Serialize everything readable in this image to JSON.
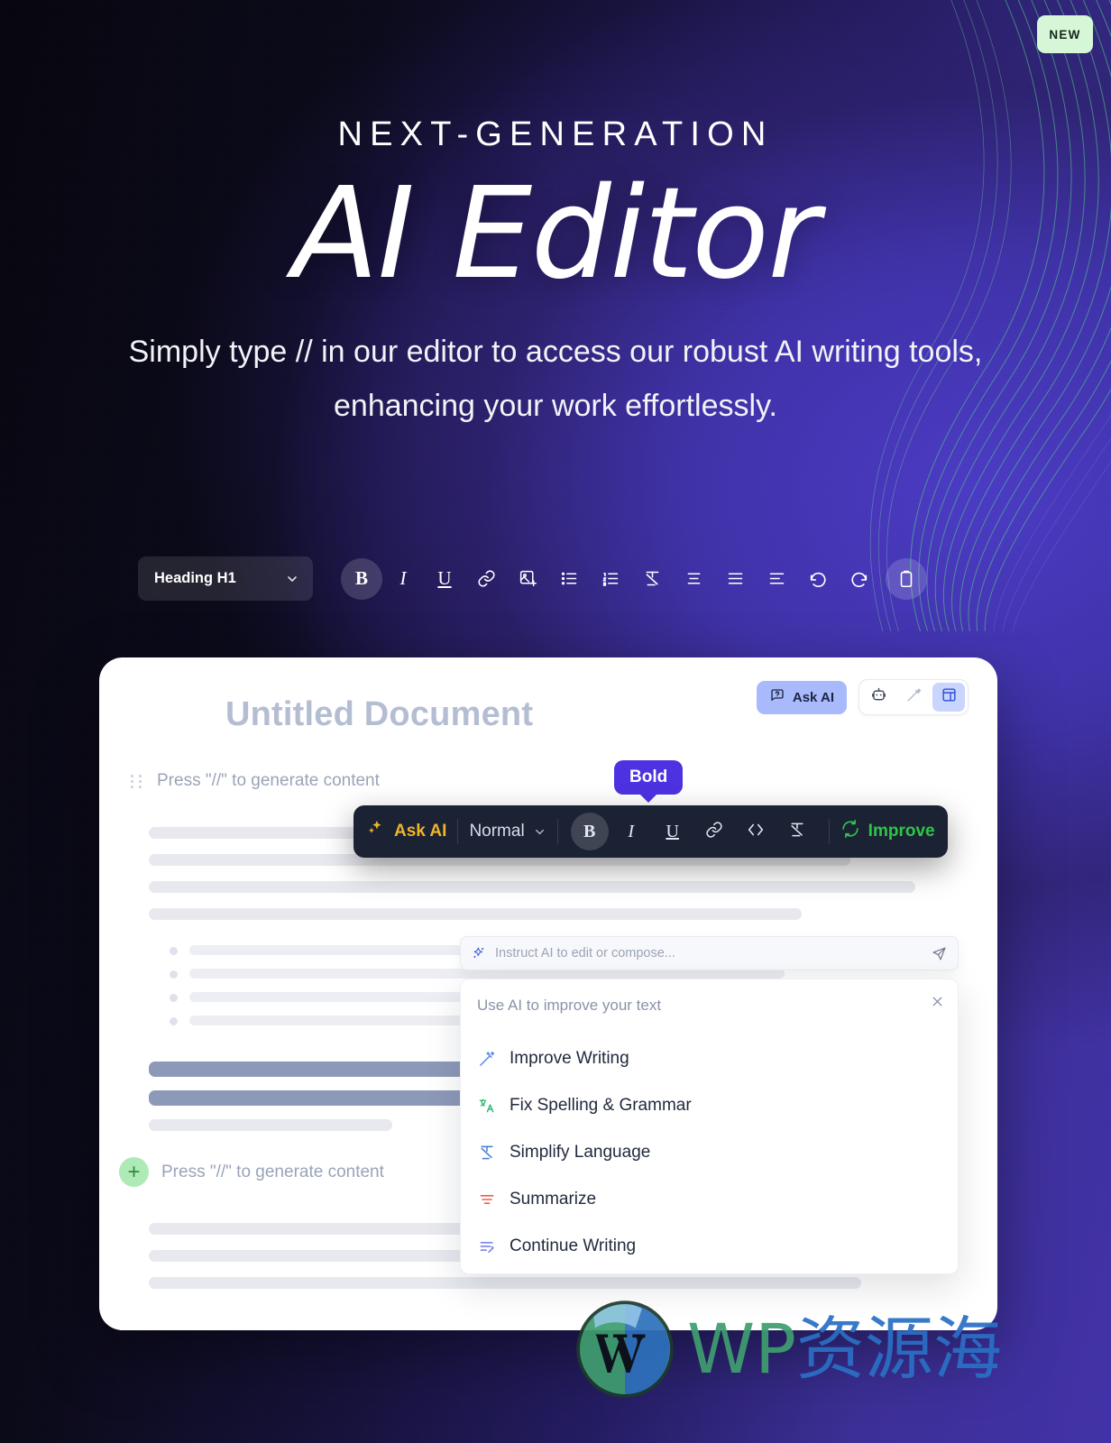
{
  "badge": {
    "label": "NEW"
  },
  "hero": {
    "kicker": "NEXT-GENERATION",
    "headline": "AI Editor",
    "subheadline": "Simply type // in our editor to access our robust AI writing tools, enhancing your work effortlessly."
  },
  "main_toolbar": {
    "heading_select": {
      "value": "Heading H1",
      "chevron_icon": "chevron-down-icon"
    },
    "buttons": [
      {
        "name": "bold-button",
        "glyph": "B",
        "icon": "bold-icon",
        "active": true
      },
      {
        "name": "italic-button",
        "glyph": "I",
        "icon": "italic-icon",
        "active": false
      },
      {
        "name": "underline-button",
        "glyph": "U",
        "icon": "underline-icon",
        "active": false
      },
      {
        "name": "link-button",
        "glyph": "",
        "icon": "link-icon",
        "active": false
      },
      {
        "name": "image-button",
        "glyph": "",
        "icon": "image-add-icon",
        "active": false
      },
      {
        "name": "bullet-list-button",
        "glyph": "",
        "icon": "bullet-list-icon",
        "active": false
      },
      {
        "name": "numbered-list-button",
        "glyph": "",
        "icon": "numbered-list-icon",
        "active": false
      },
      {
        "name": "clear-format-button",
        "glyph": "",
        "icon": "clear-formatting-icon",
        "active": false
      },
      {
        "name": "align-center-button",
        "glyph": "",
        "icon": "align-center-icon",
        "active": false
      },
      {
        "name": "align-justify-button",
        "glyph": "",
        "icon": "align-justify-icon",
        "active": false
      },
      {
        "name": "align-left-button",
        "glyph": "",
        "icon": "align-left-icon",
        "active": false
      },
      {
        "name": "undo-button",
        "glyph": "",
        "icon": "undo-icon",
        "active": false
      },
      {
        "name": "redo-button",
        "glyph": "",
        "icon": "redo-icon",
        "active": false
      },
      {
        "name": "clipboard-button",
        "glyph": "",
        "icon": "clipboard-icon",
        "active": true
      }
    ]
  },
  "document": {
    "title": "Untitled Document",
    "ask_ai_label": "Ask AI",
    "ask_ai_icon": "chat-question-icon",
    "head_icons": [
      {
        "name": "ai-bot-icon",
        "selected": false
      },
      {
        "name": "magic-wand-icon",
        "selected": false
      },
      {
        "name": "layout-panel-icon",
        "selected": true
      }
    ],
    "slash_placeholder_top": "Press \"//\" to generate content",
    "slash_placeholder_bottom": "Press \"//\" to generate content",
    "drag_handle_icon": "drag-handle-icon",
    "add_block_icon": "plus-icon"
  },
  "bold_tooltip": {
    "label": "Bold"
  },
  "float_bar": {
    "ask_ai_label": "Ask AI",
    "ask_ai_icon": "sparkles-icon",
    "style_select": {
      "value": "Normal",
      "chevron_icon": "chevron-down-icon"
    },
    "buttons": [
      {
        "name": "bold-button",
        "glyph": "B",
        "icon": "bold-icon",
        "active": true
      },
      {
        "name": "italic-button",
        "glyph": "I",
        "icon": "italic-icon",
        "active": false
      },
      {
        "name": "underline-button",
        "glyph": "U",
        "icon": "underline-icon",
        "active": false
      },
      {
        "name": "link-button",
        "glyph": "",
        "icon": "link-icon",
        "active": false
      },
      {
        "name": "code-button",
        "glyph": "",
        "icon": "code-brackets-icon",
        "active": false
      },
      {
        "name": "clear-format-button",
        "glyph": "",
        "icon": "clear-formatting-icon",
        "active": false
      }
    ],
    "improve_label": "Improve",
    "improve_icon": "refresh-icon"
  },
  "ai_prompt": {
    "placeholder": "Instruct AI to edit or compose...",
    "leading_icon": "sparkles-plus-icon",
    "send_icon": "send-icon"
  },
  "ai_menu": {
    "title": "Use AI to improve your text",
    "close_icon": "close-icon",
    "items": [
      {
        "label": "Improve Writing",
        "icon": "magic-wand-icon",
        "color": "#5b8def"
      },
      {
        "label": "Fix Spelling & Grammar",
        "icon": "spellcheck-icon",
        "color": "#2eb872"
      },
      {
        "label": "Simplify Language",
        "icon": "simplify-icon",
        "color": "#3e7fd1"
      },
      {
        "label": "Summarize",
        "icon": "summarize-icon",
        "color": "#e8604c"
      },
      {
        "label": "Continue Writing",
        "icon": "continue-writing-icon",
        "color": "#6f7ae8"
      }
    ]
  },
  "watermark": {
    "logo_icon": "wordpress-logo-icon",
    "text_en": "WP",
    "text_cn": "资源海"
  },
  "colors": {
    "accent_purple": "#4c32e0",
    "badge_green": "#d5f7d7",
    "ask_ai_yellow": "#f0b429",
    "improve_green": "#2fc44a",
    "chip_blue": "#a8bafc",
    "doc_title_gray": "#b5bdd3"
  }
}
